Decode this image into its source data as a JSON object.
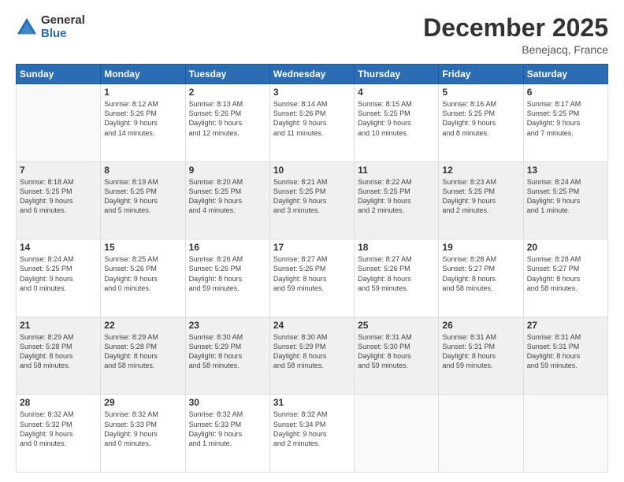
{
  "logo": {
    "general": "General",
    "blue": "Blue"
  },
  "title": "December 2025",
  "location": "Benejacq, France",
  "days_of_week": [
    "Sunday",
    "Monday",
    "Tuesday",
    "Wednesday",
    "Thursday",
    "Friday",
    "Saturday"
  ],
  "weeks": [
    [
      {
        "day": "",
        "sunrise": "",
        "sunset": "",
        "daylight": ""
      },
      {
        "day": "1",
        "sunrise": "Sunrise: 8:12 AM",
        "sunset": "Sunset: 5:26 PM",
        "daylight": "Daylight: 9 hours and 14 minutes."
      },
      {
        "day": "2",
        "sunrise": "Sunrise: 8:13 AM",
        "sunset": "Sunset: 5:26 PM",
        "daylight": "Daylight: 9 hours and 12 minutes."
      },
      {
        "day": "3",
        "sunrise": "Sunrise: 8:14 AM",
        "sunset": "Sunset: 5:26 PM",
        "daylight": "Daylight: 9 hours and 11 minutes."
      },
      {
        "day": "4",
        "sunrise": "Sunrise: 8:15 AM",
        "sunset": "Sunset: 5:25 PM",
        "daylight": "Daylight: 9 hours and 10 minutes."
      },
      {
        "day": "5",
        "sunrise": "Sunrise: 8:16 AM",
        "sunset": "Sunset: 5:25 PM",
        "daylight": "Daylight: 9 hours and 8 minutes."
      },
      {
        "day": "6",
        "sunrise": "Sunrise: 8:17 AM",
        "sunset": "Sunset: 5:25 PM",
        "daylight": "Daylight: 9 hours and 7 minutes."
      }
    ],
    [
      {
        "day": "7",
        "sunrise": "Sunrise: 8:18 AM",
        "sunset": "Sunset: 5:25 PM",
        "daylight": "Daylight: 9 hours and 6 minutes."
      },
      {
        "day": "8",
        "sunrise": "Sunrise: 8:19 AM",
        "sunset": "Sunset: 5:25 PM",
        "daylight": "Daylight: 9 hours and 5 minutes."
      },
      {
        "day": "9",
        "sunrise": "Sunrise: 8:20 AM",
        "sunset": "Sunset: 5:25 PM",
        "daylight": "Daylight: 9 hours and 4 minutes."
      },
      {
        "day": "10",
        "sunrise": "Sunrise: 8:21 AM",
        "sunset": "Sunset: 5:25 PM",
        "daylight": "Daylight: 9 hours and 3 minutes."
      },
      {
        "day": "11",
        "sunrise": "Sunrise: 8:22 AM",
        "sunset": "Sunset: 5:25 PM",
        "daylight": "Daylight: 9 hours and 2 minutes."
      },
      {
        "day": "12",
        "sunrise": "Sunrise: 8:23 AM",
        "sunset": "Sunset: 5:25 PM",
        "daylight": "Daylight: 9 hours and 2 minutes."
      },
      {
        "day": "13",
        "sunrise": "Sunrise: 8:24 AM",
        "sunset": "Sunset: 5:25 PM",
        "daylight": "Daylight: 9 hours and 1 minute."
      }
    ],
    [
      {
        "day": "14",
        "sunrise": "Sunrise: 8:24 AM",
        "sunset": "Sunset: 5:25 PM",
        "daylight": "Daylight: 9 hours and 0 minutes."
      },
      {
        "day": "15",
        "sunrise": "Sunrise: 8:25 AM",
        "sunset": "Sunset: 5:26 PM",
        "daylight": "Daylight: 9 hours and 0 minutes."
      },
      {
        "day": "16",
        "sunrise": "Sunrise: 8:26 AM",
        "sunset": "Sunset: 5:26 PM",
        "daylight": "Daylight: 8 hours and 59 minutes."
      },
      {
        "day": "17",
        "sunrise": "Sunrise: 8:27 AM",
        "sunset": "Sunset: 5:26 PM",
        "daylight": "Daylight: 8 hours and 59 minutes."
      },
      {
        "day": "18",
        "sunrise": "Sunrise: 8:27 AM",
        "sunset": "Sunset: 5:26 PM",
        "daylight": "Daylight: 8 hours and 59 minutes."
      },
      {
        "day": "19",
        "sunrise": "Sunrise: 8:28 AM",
        "sunset": "Sunset: 5:27 PM",
        "daylight": "Daylight: 8 hours and 58 minutes."
      },
      {
        "day": "20",
        "sunrise": "Sunrise: 8:28 AM",
        "sunset": "Sunset: 5:27 PM",
        "daylight": "Daylight: 8 hours and 58 minutes."
      }
    ],
    [
      {
        "day": "21",
        "sunrise": "Sunrise: 8:29 AM",
        "sunset": "Sunset: 5:28 PM",
        "daylight": "Daylight: 8 hours and 58 minutes."
      },
      {
        "day": "22",
        "sunrise": "Sunrise: 8:29 AM",
        "sunset": "Sunset: 5:28 PM",
        "daylight": "Daylight: 8 hours and 58 minutes."
      },
      {
        "day": "23",
        "sunrise": "Sunrise: 8:30 AM",
        "sunset": "Sunset: 5:29 PM",
        "daylight": "Daylight: 8 hours and 58 minutes."
      },
      {
        "day": "24",
        "sunrise": "Sunrise: 8:30 AM",
        "sunset": "Sunset: 5:29 PM",
        "daylight": "Daylight: 8 hours and 58 minutes."
      },
      {
        "day": "25",
        "sunrise": "Sunrise: 8:31 AM",
        "sunset": "Sunset: 5:30 PM",
        "daylight": "Daylight: 8 hours and 59 minutes."
      },
      {
        "day": "26",
        "sunrise": "Sunrise: 8:31 AM",
        "sunset": "Sunset: 5:31 PM",
        "daylight": "Daylight: 8 hours and 59 minutes."
      },
      {
        "day": "27",
        "sunrise": "Sunrise: 8:31 AM",
        "sunset": "Sunset: 5:31 PM",
        "daylight": "Daylight: 8 hours and 59 minutes."
      }
    ],
    [
      {
        "day": "28",
        "sunrise": "Sunrise: 8:32 AM",
        "sunset": "Sunset: 5:32 PM",
        "daylight": "Daylight: 9 hours and 0 minutes."
      },
      {
        "day": "29",
        "sunrise": "Sunrise: 8:32 AM",
        "sunset": "Sunset: 5:33 PM",
        "daylight": "Daylight: 9 hours and 0 minutes."
      },
      {
        "day": "30",
        "sunrise": "Sunrise: 8:32 AM",
        "sunset": "Sunset: 5:33 PM",
        "daylight": "Daylight: 9 hours and 1 minute."
      },
      {
        "day": "31",
        "sunrise": "Sunrise: 8:32 AM",
        "sunset": "Sunset: 5:34 PM",
        "daylight": "Daylight: 9 hours and 2 minutes."
      },
      {
        "day": "",
        "sunrise": "",
        "sunset": "",
        "daylight": ""
      },
      {
        "day": "",
        "sunrise": "",
        "sunset": "",
        "daylight": ""
      },
      {
        "day": "",
        "sunrise": "",
        "sunset": "",
        "daylight": ""
      }
    ]
  ]
}
